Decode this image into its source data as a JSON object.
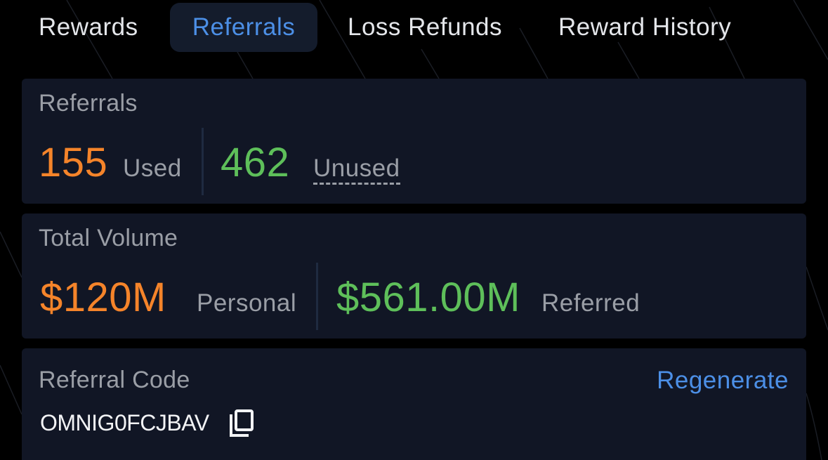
{
  "tabs": [
    {
      "label": "Rewards",
      "active": false
    },
    {
      "label": "Referrals",
      "active": true
    },
    {
      "label": "Loss Refunds",
      "active": false
    },
    {
      "label": "Reward History",
      "active": false
    }
  ],
  "referrals_card": {
    "title": "Referrals",
    "used_count": "155",
    "used_label": "Used",
    "unused_count": "462",
    "unused_label": "Unused"
  },
  "volume_card": {
    "title": "Total Volume",
    "personal_value": "$120M",
    "personal_label": "Personal",
    "referred_value": "$561.00M",
    "referred_label": "Referred"
  },
  "code_card": {
    "title": "Referral Code",
    "regenerate_label": "Regenerate",
    "code": "OMNIG0FCJBAV",
    "copy_icon": "copy-icon"
  },
  "colors": {
    "background": "#000000",
    "card": "#111625",
    "active_tab_bg": "#141c2c",
    "accent_blue": "#4c8fe6",
    "orange": "#f5842a",
    "green": "#5ebf5a",
    "muted_text": "#9a9ea6"
  }
}
